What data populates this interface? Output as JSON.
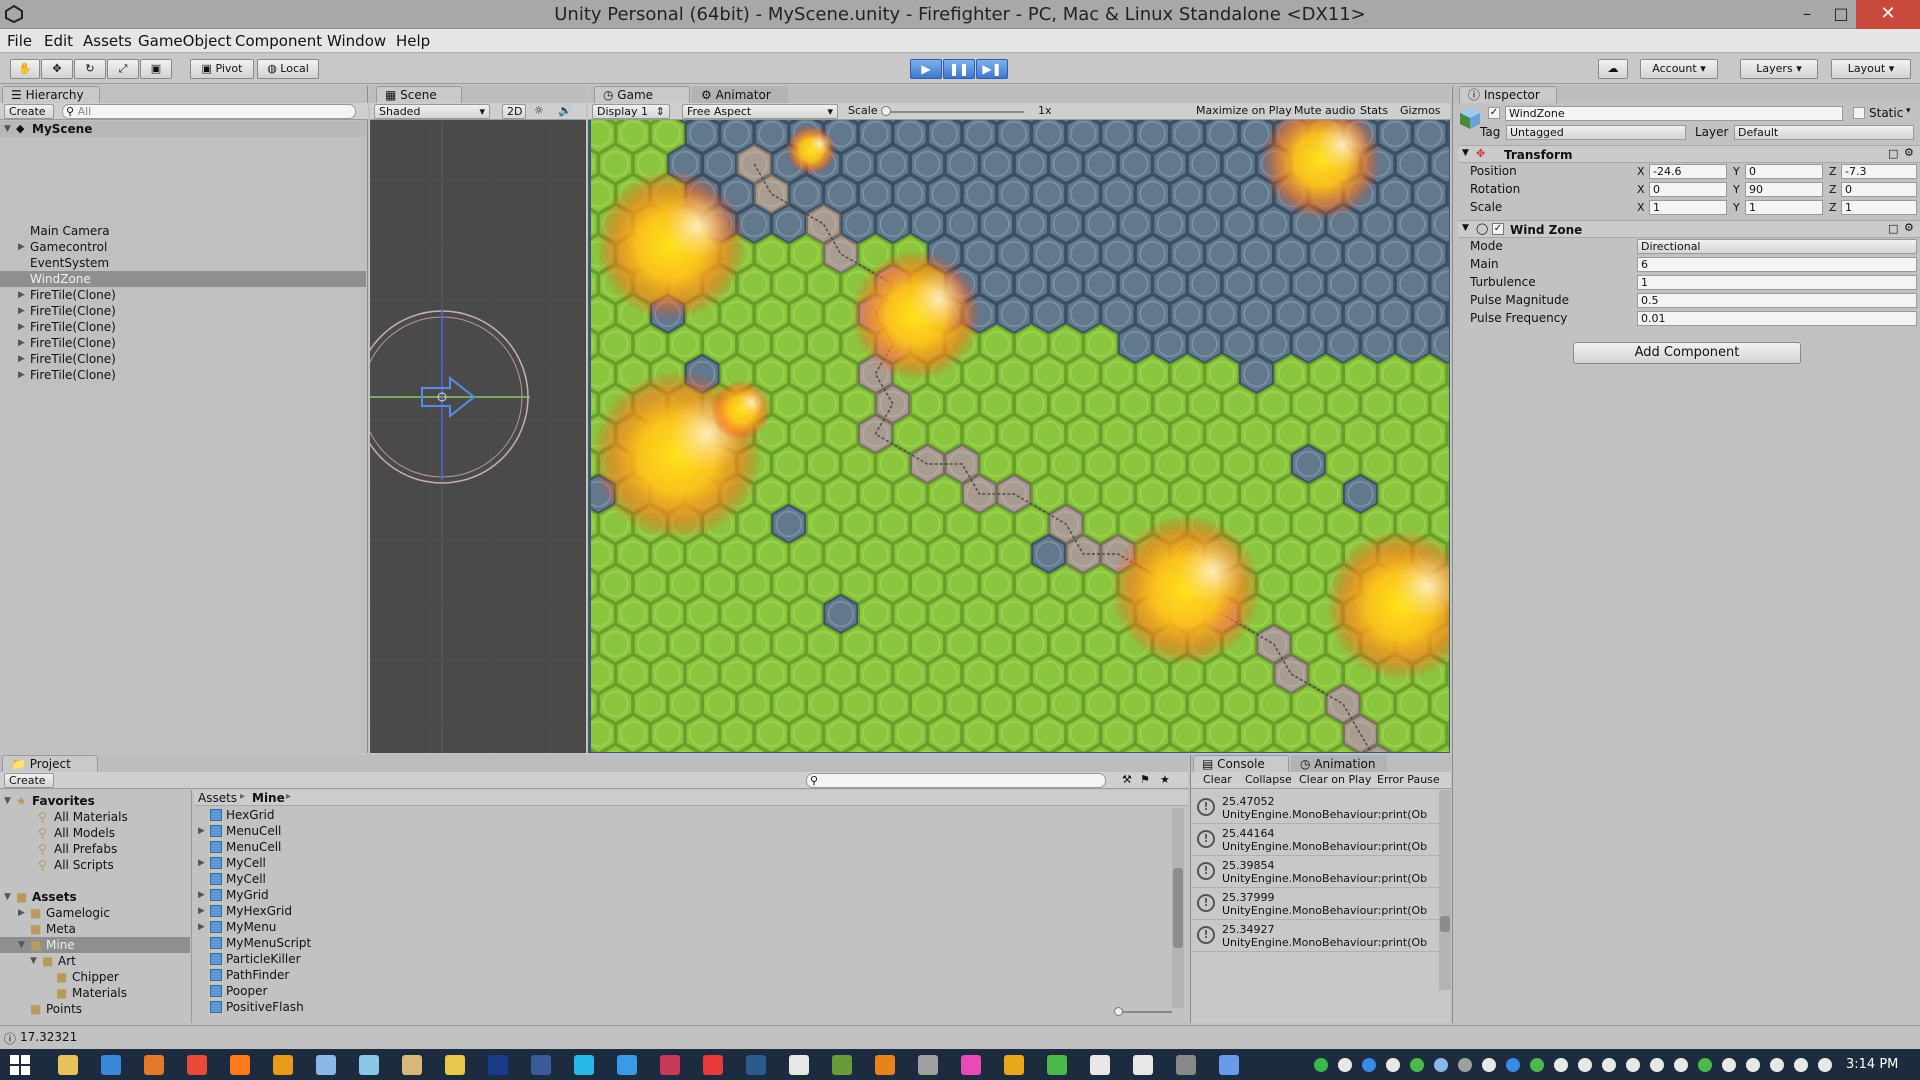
{
  "window": {
    "title": "Unity Personal (64bit) - MyScene.unity - Firefighter - PC, Mac & Linux Standalone <DX11>"
  },
  "menu": [
    "File",
    "Edit",
    "Assets",
    "GameObject",
    "Component",
    "Window",
    "Help"
  ],
  "toolbar": {
    "pivot": "Pivot",
    "local": "Local",
    "account": "Account",
    "layers": "Layers",
    "layout": "Layout"
  },
  "hierarchy": {
    "tab": "Hierarchy",
    "create": "Create",
    "search_placeholder": "All",
    "scene": "MyScene",
    "items": [
      {
        "label": "Main Camera",
        "expandable": false,
        "selected": false
      },
      {
        "label": "Gamecontrol",
        "expandable": true,
        "selected": false
      },
      {
        "label": "EventSystem",
        "expandable": false,
        "selected": false
      },
      {
        "label": "WindZone",
        "expandable": false,
        "selected": true
      },
      {
        "label": "FireTile(Clone)",
        "expandable": true,
        "selected": false
      },
      {
        "label": "FireTile(Clone)",
        "expandable": true,
        "selected": false
      },
      {
        "label": "FireTile(Clone)",
        "expandable": true,
        "selected": false
      },
      {
        "label": "FireTile(Clone)",
        "expandable": true,
        "selected": false
      },
      {
        "label": "FireTile(Clone)",
        "expandable": true,
        "selected": false
      },
      {
        "label": "FireTile(Clone)",
        "expandable": true,
        "selected": false
      }
    ]
  },
  "scene": {
    "tab": "Scene",
    "shading": "Shaded",
    "mode_2d": "2D"
  },
  "game": {
    "tab": "Game",
    "animator_tab": "Animator",
    "display": "Display 1",
    "aspect": "Free Aspect",
    "scale_label": "Scale",
    "scale_value": "1x",
    "maximize": "Maximize on Play",
    "mute": "Mute audio",
    "stats": "Stats",
    "gizmos": "Gizmos"
  },
  "inspector": {
    "tab": "Inspector",
    "object_name": "WindZone",
    "static": "Static",
    "tag_label": "Tag",
    "tag": "Untagged",
    "layer_label": "Layer",
    "layer": "Default",
    "transform": {
      "title": "Transform",
      "position": {
        "label": "Position",
        "x": "-24.6",
        "y": "0",
        "z": "-7.3"
      },
      "rotation": {
        "label": "Rotation",
        "x": "0",
        "y": "90",
        "z": "0"
      },
      "scale": {
        "label": "Scale",
        "x": "1",
        "y": "1",
        "z": "1"
      }
    },
    "windzone": {
      "title": "Wind Zone",
      "props": [
        {
          "label": "Mode",
          "value": "Directional"
        },
        {
          "label": "Main",
          "value": "6"
        },
        {
          "label": "Turbulence",
          "value": "1"
        },
        {
          "label": "Pulse Magnitude",
          "value": "0.5"
        },
        {
          "label": "Pulse Frequency",
          "value": "0.01"
        }
      ]
    },
    "add_component": "Add Component"
  },
  "project": {
    "tab": "Project",
    "create": "Create",
    "favorites_title": "Favorites",
    "favorites": [
      "All Materials",
      "All Models",
      "All Prefabs",
      "All Scripts"
    ],
    "assets_title": "Assets",
    "folders": [
      "Gamelogic",
      "Meta",
      "Mine",
      "Art",
      "Chipper",
      "Materials",
      "Points"
    ],
    "breadcrumb": [
      "Assets",
      "Mine"
    ],
    "files": [
      "HexGrid",
      "MenuCell",
      "MenuCell",
      "MyCell",
      "MyCell",
      "MyGrid",
      "MyHexGrid",
      "MyMenu",
      "MyMenuScript",
      "ParticleKiller",
      "PathFinder",
      "Pooper",
      "PositiveFlash"
    ]
  },
  "console": {
    "tab": "Console",
    "animation_tab": "Animation",
    "clear": "Clear",
    "collapse": "Collapse",
    "clear_on_play": "Clear on Play",
    "error_pause": "Error Pause",
    "logs": [
      {
        "value": "25.47052",
        "source": "UnityEngine.MonoBehaviour:print(Ob"
      },
      {
        "value": "25.44164",
        "source": "UnityEngine.MonoBehaviour:print(Ob"
      },
      {
        "value": "25.39854",
        "source": "UnityEngine.MonoBehaviour:print(Ob"
      },
      {
        "value": "25.37999",
        "source": "UnityEngine.MonoBehaviour:print(Ob"
      },
      {
        "value": "25.34927",
        "source": "UnityEngine.MonoBehaviour:print(Ob"
      }
    ]
  },
  "status": {
    "message": "17.32321"
  },
  "taskbar": {
    "clock": "3:14 PM"
  },
  "colors": {
    "grass": "#8cc63f",
    "stone": "#62788c",
    "road": "#a89c90",
    "fire": "#ffd41a",
    "play": "#3d78cf"
  }
}
